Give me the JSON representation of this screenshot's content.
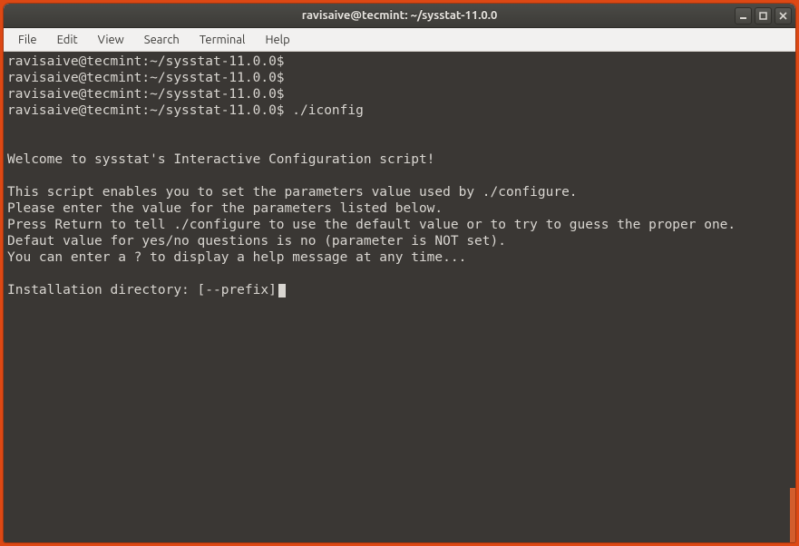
{
  "window": {
    "title": "ravisaive@tecmint: ~/sysstat-11.0.0"
  },
  "menu": {
    "file": "File",
    "edit": "Edit",
    "view": "View",
    "search": "Search",
    "terminal": "Terminal",
    "help": "Help"
  },
  "icons": {
    "minimize": "minimize",
    "maximize": "maximize",
    "close": "close"
  },
  "terminal": {
    "lines": [
      "ravisaive@tecmint:~/sysstat-11.0.0$ ",
      "ravisaive@tecmint:~/sysstat-11.0.0$ ",
      "ravisaive@tecmint:~/sysstat-11.0.0$ ",
      "ravisaive@tecmint:~/sysstat-11.0.0$ ./iconfig",
      "",
      "",
      "Welcome to sysstat's Interactive Configuration script!",
      "",
      "This script enables you to set the parameters value used by ./configure.",
      "Please enter the value for the parameters listed below.",
      "Press Return to tell ./configure to use the default value or to try to guess the proper one.",
      "Defaut value for yes/no questions is no (parameter is NOT set).",
      "You can enter a ? to display a help message at any time...",
      "",
      "Installation directory: [--prefix]"
    ]
  }
}
